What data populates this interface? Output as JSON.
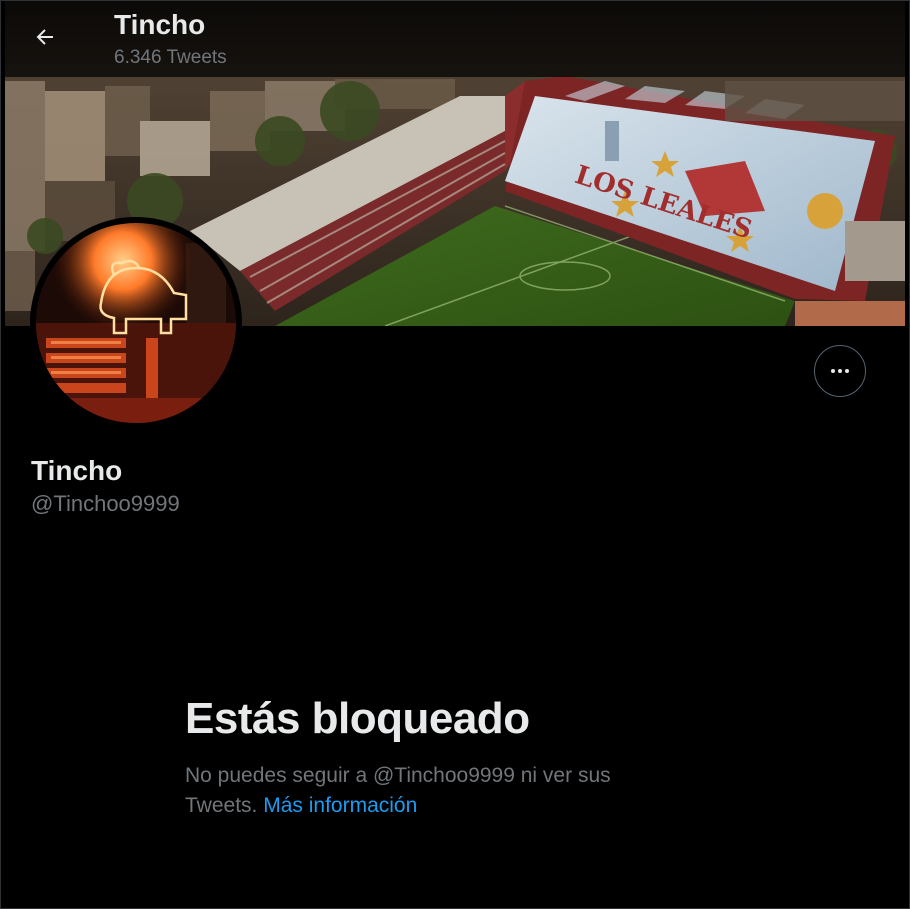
{
  "header": {
    "title": "Tincho",
    "tweet_count": "6.346 Tweets",
    "back_icon": "arrow-left-icon"
  },
  "profile": {
    "display_name": "Tincho",
    "handle": "@Tinchoo9999",
    "banner_text": "LOS LEALES",
    "more_icon": "more-horizontal-icon"
  },
  "blocked": {
    "title": "Estás bloqueado",
    "message": "No puedes seguir a @Tinchoo9999 ni ver sus Tweets.",
    "link": "Más información"
  },
  "colors": {
    "background": "#000000",
    "text_primary": "#e7e9ea",
    "text_secondary": "#71767b",
    "link": "#1d9bf0",
    "border": "#536471"
  }
}
